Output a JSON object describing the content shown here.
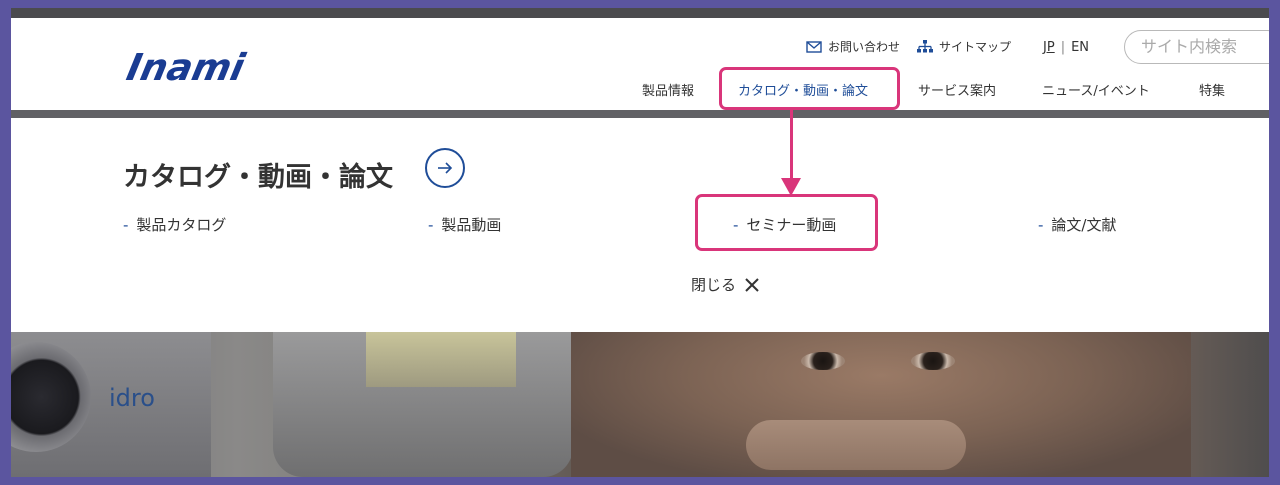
{
  "header": {
    "logo_text": "Inami",
    "utility": {
      "contact_label": "お問い合わせ",
      "sitemap_label": "サイトマップ",
      "lang_jp": "JP",
      "lang_sep": "|",
      "lang_en": "EN",
      "search_placeholder": "サイト内検索"
    },
    "nav": [
      {
        "label": "製品情報"
      },
      {
        "label": "カタログ・動画・論文"
      },
      {
        "label": "サービス案内"
      },
      {
        "label": "ニュース/イベント"
      },
      {
        "label": "特集"
      }
    ]
  },
  "mega_menu": {
    "title": "カタログ・動画・論文",
    "dash": "-",
    "items": [
      {
        "label": "製品カタログ"
      },
      {
        "label": "製品動画"
      },
      {
        "label": "セミナー動画"
      },
      {
        "label": "論文/文献"
      }
    ],
    "close_label": "閉じる"
  },
  "hero": {
    "brand_text": "idro"
  },
  "colors": {
    "brand_blue": "#1a3c92",
    "accent_blue": "#1f4d98",
    "annotation_pink": "#d9357a",
    "frame_purple": "#5b559f"
  },
  "icons": [
    "mail-icon",
    "sitemap-icon",
    "arrow-right-icon",
    "close-icon"
  ]
}
